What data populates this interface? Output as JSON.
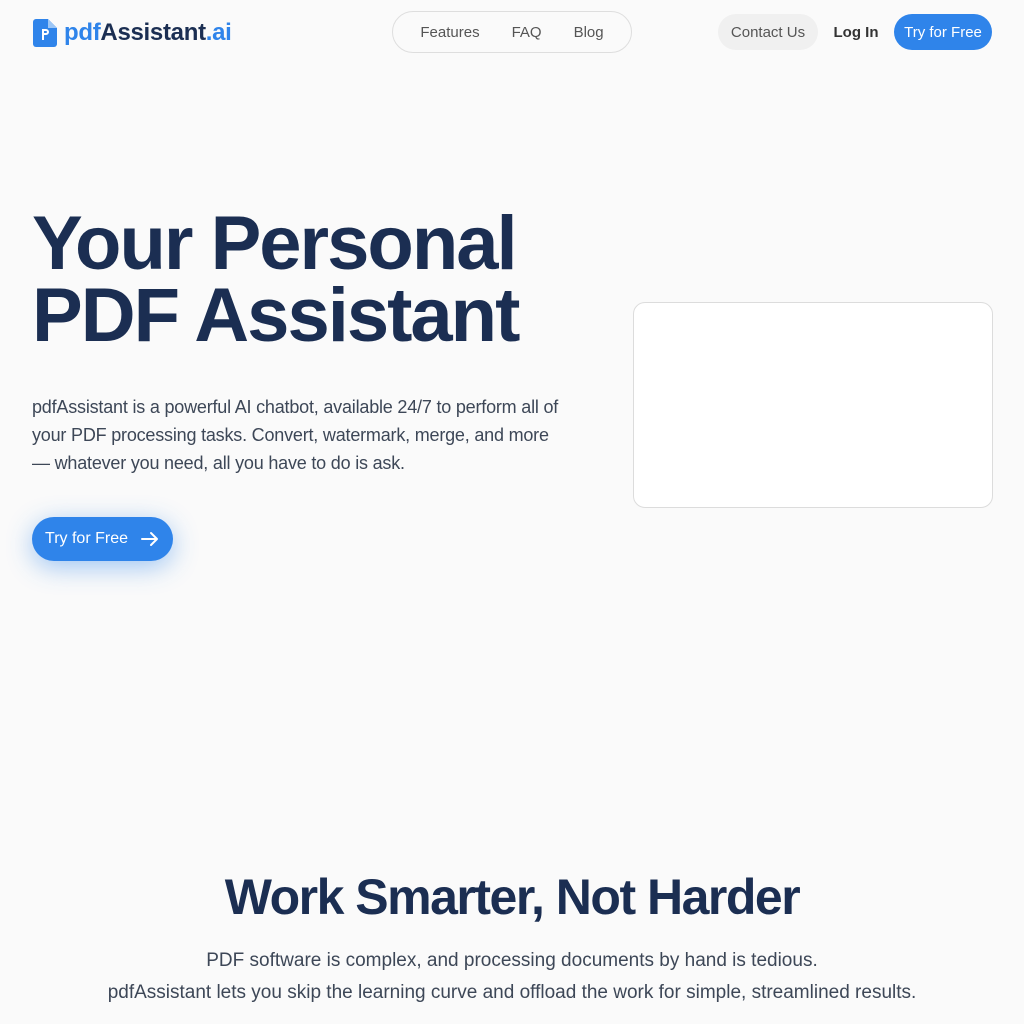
{
  "brand": {
    "pdf": "pdf",
    "main": "Assistant",
    "ai": ".ai",
    "icon": "pdf-document-icon",
    "accent_color": "#2f84ea",
    "text_color": "#1b2e52"
  },
  "nav": {
    "links": [
      "Features",
      "FAQ",
      "Blog"
    ],
    "contact_label": "Contact Us",
    "login_label": "Log In",
    "try_label": "Try for Free"
  },
  "hero": {
    "title_line1": "Your Personal",
    "title_line2": "PDF Assistant",
    "description": "pdfAssistant is a powerful AI chatbot, available 24/7 to perform all of your PDF processing tasks. Convert, watermark, merge, and more — whatever you need, all you have to do is ask.",
    "cta_label": "Try for Free",
    "cta_icon": "arrow-right-icon"
  },
  "section": {
    "title": "Work Smarter, Not Harder",
    "line1": "PDF software is complex, and processing documents by hand is tedious.",
    "line2": "pdfAssistant lets you skip the learning curve and offload the work for simple, streamlined results."
  }
}
